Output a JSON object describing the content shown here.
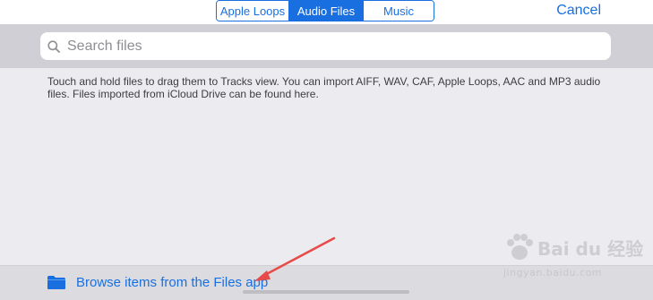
{
  "segmented_control": {
    "items": [
      {
        "label": "Apple Loops",
        "selected": false
      },
      {
        "label": "Audio Files",
        "selected": true
      },
      {
        "label": "Music",
        "selected": false
      }
    ]
  },
  "header": {
    "cancel_label": "Cancel"
  },
  "search": {
    "placeholder": "Search files",
    "value": ""
  },
  "info_text": "Touch and hold files to drag them to Tracks view. You can import AIFF, WAV, CAF, Apple Loops, AAC and MP3 audio files. Files imported from iCloud Drive can be found here.",
  "bottom_bar": {
    "browse_label": "Browse items from the Files app"
  },
  "watermark": {
    "brand": "Bai du 经验",
    "url": "jingyan.baidu.com"
  },
  "colors": {
    "accent": "#1a6fe0",
    "annotation_arrow": "#e84a4a",
    "background": "#ebebf0",
    "search_band": "#cfcfd5"
  },
  "icons": {
    "search": "search-icon",
    "browse": "folder-icon"
  }
}
